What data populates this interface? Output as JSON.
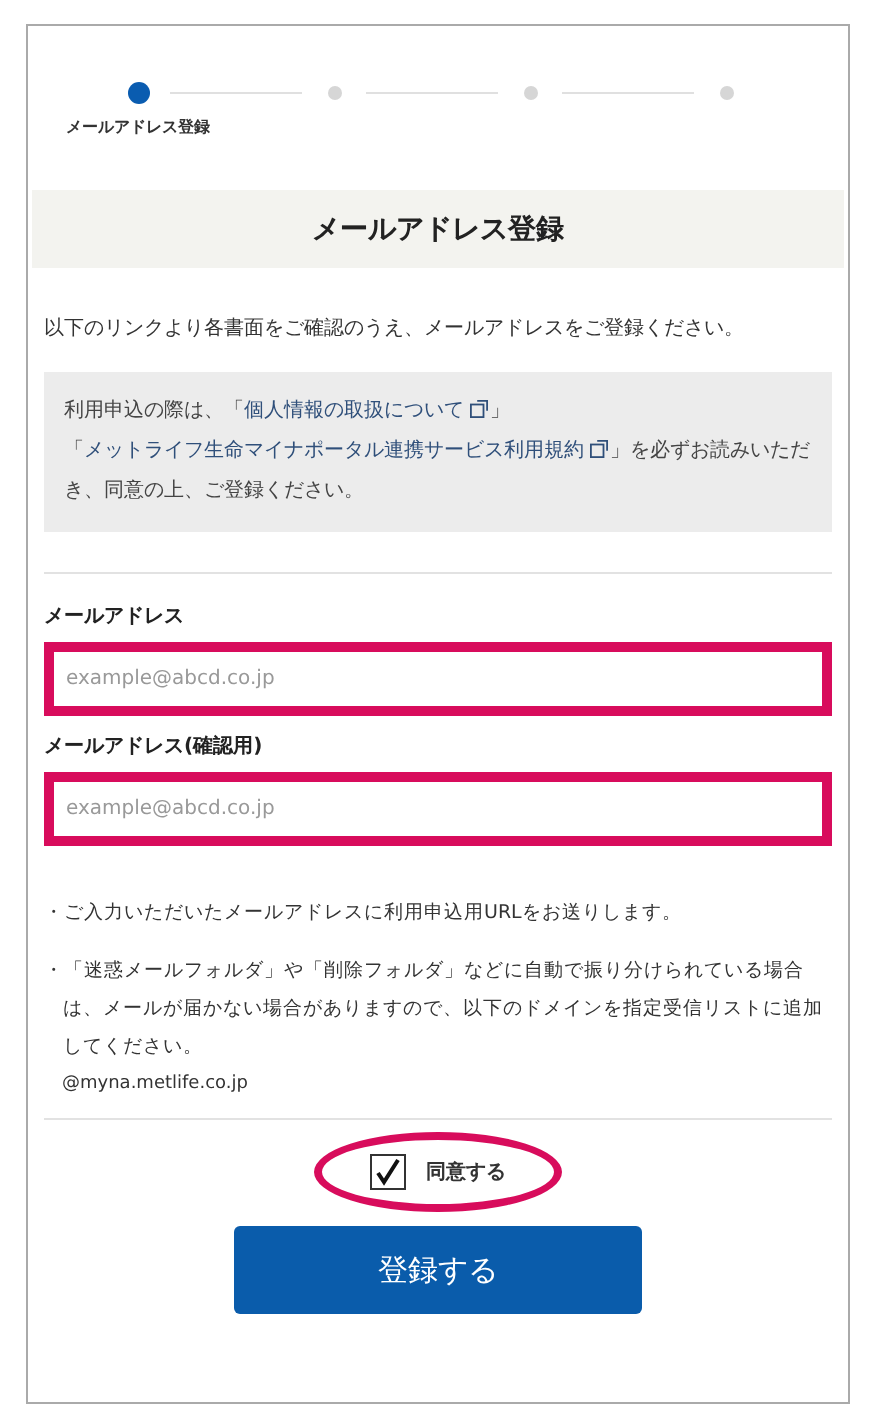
{
  "stepper": {
    "steps": [
      {
        "label": "メールアドレス登録",
        "selected": true
      },
      {
        "selected": false
      },
      {
        "selected": false
      },
      {
        "selected": false
      }
    ]
  },
  "title": "メールアドレス登録",
  "intro": "以下のリンクより各書面をご確認のうえ、メールアドレスをご登録ください。",
  "notice": [
    {
      "kind": "text",
      "text": "利用申込の際は、「"
    },
    {
      "kind": "link",
      "text": "個人情報の取扱について"
    },
    {
      "kind": "text",
      "text": "」「"
    },
    {
      "kind": "link",
      "text": "メットライフ生命マイナポータル連携サービス利用規約"
    },
    {
      "kind": "text",
      "text": "」を必ずお読みいただき、同意の上、ご登録ください。"
    }
  ],
  "fields": [
    {
      "label": "メールアドレス",
      "placeholder": "example@abcd.co.jp",
      "highlighted": true
    },
    {
      "label": "メールアドレス(確認用)",
      "placeholder": "example@abcd.co.jp",
      "highlighted": true
    }
  ],
  "notes": [
    "・ご入力いただいたメールアドレスに利用申込用URLをお送りします。",
    "・「迷惑メールフォルダ」や「削除フォルダ」などに自動で振り分けられている場合は、メールが届かない場合がありますので、以下のドメインを指定受信リストに追加してください。"
  ],
  "domain": "@myna.metlife.co.jp",
  "agree": {
    "label": "同意する",
    "checked": true,
    "highlighted": true
  },
  "submit": "登録する"
}
